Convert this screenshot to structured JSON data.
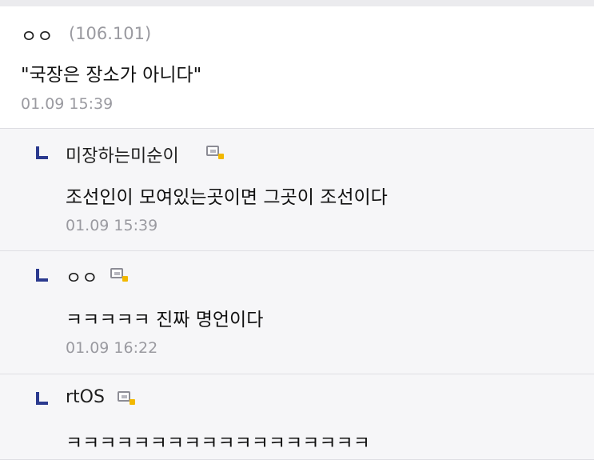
{
  "main_comment": {
    "nick": "ㅇㅇ",
    "ip": "(106.101)",
    "text": "\"국장은 장소가 아니다\"",
    "timestamp": "01.09 15:39"
  },
  "replies": [
    {
      "nick": "미장하는미순이",
      "text": "조선인이 모여있는곳이면 그곳이 조선이다",
      "timestamp": "01.09 15:39",
      "badge_icon": "fixed-nick-badge-icon"
    },
    {
      "nick": "ㅇㅇ",
      "text": "ㅋㅋㅋㅋㅋ 진짜 명언이다",
      "timestamp": "01.09 16:22",
      "badge_icon": "fixed-nick-badge-icon"
    },
    {
      "nick": "rtOS",
      "text": "ㅋㅋㅋㅋㅋㅋㅋㅋㅋㅋㅋㅋㅋㅋㅋㅋㅋㅋ",
      "timestamp": "",
      "badge_icon": "fixed-nick-badge-icon"
    }
  ],
  "colors": {
    "reply_background": "#f6f6f8",
    "reply_arrow": "#2b3a8f",
    "badge_accent": "#f2b800",
    "meta_text": "#9a9aa0"
  }
}
